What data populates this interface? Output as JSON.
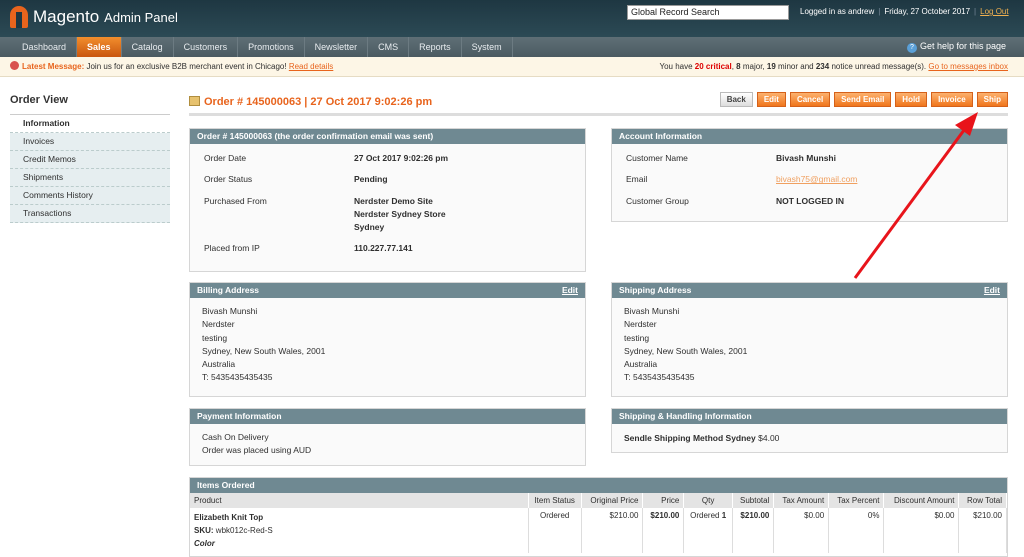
{
  "header": {
    "logo": "Magento",
    "logo_sub": "Admin Panel",
    "search_placeholder": "Global Record Search",
    "logged_in": "Logged in as andrew",
    "date": "Friday, 27 October 2017",
    "logout": "Log Out"
  },
  "nav": {
    "items": [
      "Dashboard",
      "Sales",
      "Catalog",
      "Customers",
      "Promotions",
      "Newsletter",
      "CMS",
      "Reports",
      "System"
    ],
    "help": "Get help for this page"
  },
  "message": {
    "label": "Latest Message:",
    "text": "Join us for an exclusive B2B merchant event in Chicago!",
    "link": "Read details",
    "pre": "You have",
    "critical": "20 critical",
    "major_n": "8",
    "major": "major,",
    "minor_n": "19",
    "minor": "minor and",
    "notice_n": "234",
    "notice": "notice unread message(s).",
    "inbox": "Go to messages inbox"
  },
  "sidebar": {
    "title": "Order View",
    "items": [
      "Information",
      "Invoices",
      "Credit Memos",
      "Shipments",
      "Comments History",
      "Transactions"
    ]
  },
  "page": {
    "title": "Order # 145000063 | 27 Oct 2017 9:02:26 pm",
    "buttons": [
      "Back",
      "Edit",
      "Cancel",
      "Send Email",
      "Hold",
      "Invoice",
      "Ship"
    ]
  },
  "order": {
    "header": "Order # 145000063 (the order confirmation email was sent)",
    "date_label": "Order Date",
    "date": "27 Oct 2017 9:02:26 pm",
    "status_label": "Order Status",
    "status": "Pending",
    "from_label": "Purchased From",
    "from": [
      "Nerdster Demo Site",
      "Nerdster Sydney Store",
      "Sydney"
    ],
    "ip_label": "Placed from IP",
    "ip": "110.227.77.141"
  },
  "account": {
    "header": "Account Information",
    "name_label": "Customer Name",
    "name": "Bivash Munshi",
    "email_label": "Email",
    "email": "bivash75@gmail.com",
    "group_label": "Customer Group",
    "group": "NOT LOGGED IN"
  },
  "billing": {
    "header": "Billing Address",
    "edit": "Edit",
    "lines": [
      "Bivash Munshi",
      "Nerdster",
      "testing",
      "Sydney, New South Wales, 2001",
      "Australia",
      "T: 5435435435435"
    ]
  },
  "shipping": {
    "header": "Shipping Address",
    "edit": "Edit",
    "lines": [
      "Bivash Munshi",
      "Nerdster",
      "testing",
      "Sydney, New South Wales, 2001",
      "Australia",
      "T: 5435435435435"
    ]
  },
  "payment": {
    "header": "Payment Information",
    "lines": [
      "Cash On Delivery",
      "Order was placed using AUD"
    ]
  },
  "shipping_method": {
    "header": "Shipping & Handling Information",
    "method": "Sendle Shipping Method Sydney",
    "price": "$4.00"
  },
  "items": {
    "header": "Items Ordered",
    "columns": [
      "Product",
      "Item Status",
      "Original Price",
      "Price",
      "Qty",
      "Subtotal",
      "Tax Amount",
      "Tax Percent",
      "Discount Amount",
      "Row Total"
    ],
    "rows": [
      {
        "name": "Elizabeth Knit Top",
        "sku_label": "SKU:",
        "sku": "wbk012c-Red-S",
        "option": "Color",
        "status": "Ordered",
        "original": "$210.00",
        "price": "$210.00",
        "qty_label": "Ordered",
        "qty": "1",
        "subtotal": "$210.00",
        "tax": "$0.00",
        "tax_pct": "0%",
        "discount": "$0.00",
        "row_total": "$210.00"
      }
    ]
  },
  "colors": {
    "accent": "#e8641d",
    "box_header": "#6f8992",
    "arrow": "#e8141b"
  }
}
